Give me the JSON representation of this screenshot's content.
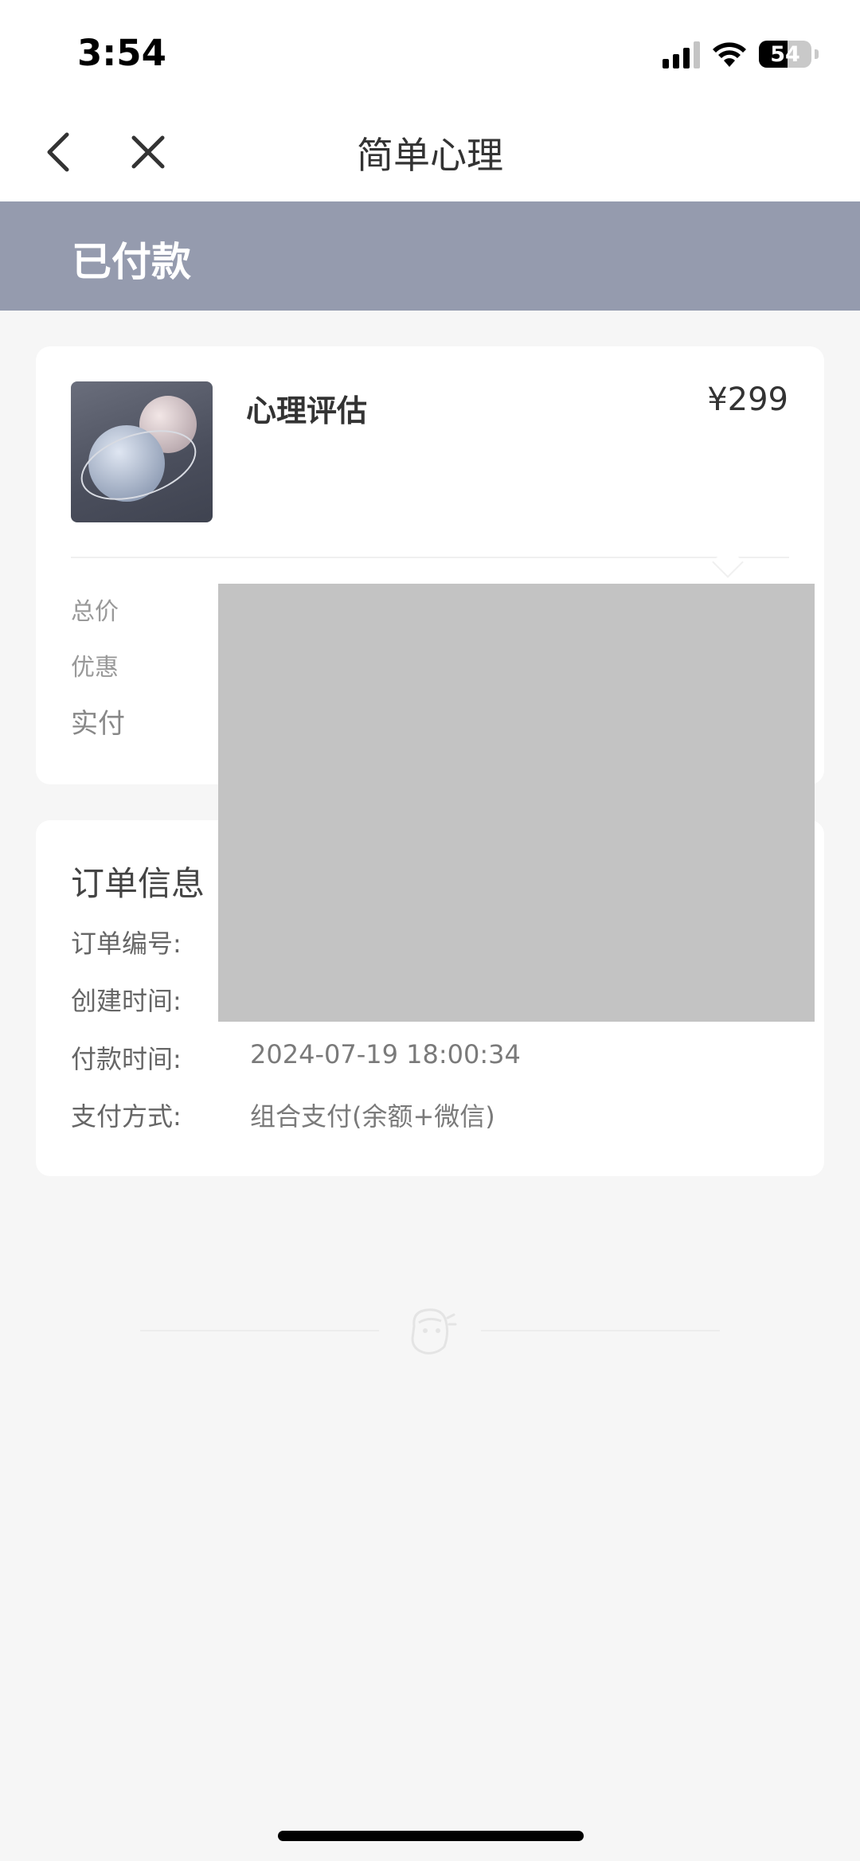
{
  "status_bar": {
    "time": "3:54",
    "battery_percent": "54",
    "battery_level": 0.54
  },
  "nav": {
    "title": "简单心理",
    "back_icon": "chevron-left-icon",
    "close_icon": "close-icon"
  },
  "banner": {
    "status": "已付款",
    "color": "#959bae"
  },
  "product": {
    "name": "心理评估",
    "price": "¥299",
    "summary_labels": {
      "total": "总价",
      "discount": "优惠",
      "paid": "实付"
    }
  },
  "order": {
    "title": "订单信息",
    "rows": [
      {
        "label": "订单编号:",
        "value": ""
      },
      {
        "label": "创建时间:",
        "value": ""
      },
      {
        "label": "付款时间:",
        "value": "2024-07-19 18:00:34"
      },
      {
        "label": "支付方式:",
        "value": "组合支付(余额+微信)"
      }
    ]
  }
}
